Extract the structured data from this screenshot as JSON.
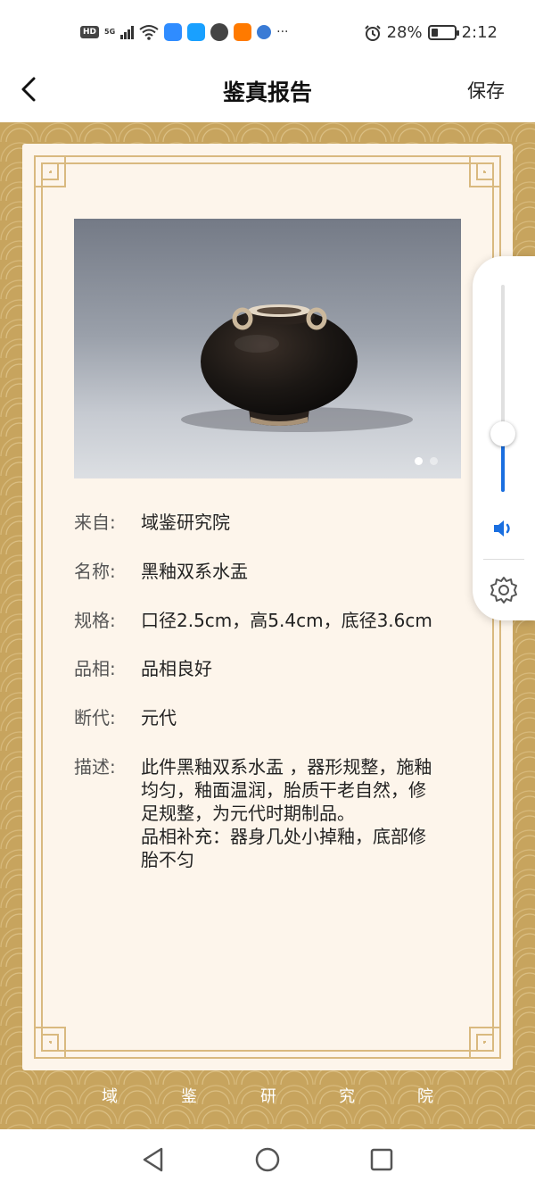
{
  "status_bar": {
    "network_badge": "HD",
    "network_type": "5G",
    "icons": [
      "signal-icon",
      "wifi-icon",
      "cloud-app-icon",
      "search-app-icon",
      "chat-app-icon",
      "taobao-app-icon",
      "browser-app-icon",
      "more-icon"
    ],
    "more": "···",
    "alarm_icon": "alarm-icon",
    "battery_percent": "28%",
    "battery_level": 0.28,
    "time": "2:12"
  },
  "nav": {
    "back_icon": "chevron-left-icon",
    "title": "鉴真报告",
    "save_label": "保存"
  },
  "report": {
    "image_dots_count": 2,
    "image_active_index": 0,
    "rows": [
      {
        "label": "来自:",
        "value": "域鉴研究院"
      },
      {
        "label": "名称:",
        "value": "黑釉双系水盂"
      },
      {
        "label": "规格:",
        "value": "口径2.5cm，高5.4cm，底径3.6cm"
      },
      {
        "label": "品相:",
        "value": "品相良好"
      },
      {
        "label": "断代:",
        "value": "元代"
      }
    ],
    "description": {
      "label": "描述:",
      "lines": [
        "此件黑釉双系水盂 ，器形规整，施釉",
        "均匀，釉面温润，胎质干老自然，修",
        "足规整，为元代时期制品。",
        "品相补充：器身几处小掉釉，底部修",
        "胎不匀"
      ]
    },
    "footer_chars": [
      "域",
      "鉴",
      "研",
      "究",
      "院"
    ]
  },
  "volume_panel": {
    "level": 0.28,
    "accent_color": "#1a6fe0",
    "speaker_icon": "speaker-icon",
    "settings_icon": "gear-icon"
  },
  "bottom_nav": {
    "back_icon": "triangle-back-icon",
    "home_icon": "circle-home-icon",
    "recents_icon": "square-recents-icon"
  },
  "colors": {
    "frame_gold": "#c7a45e",
    "card_bg": "#fdf5eb",
    "border_line": "#d9b97f"
  }
}
